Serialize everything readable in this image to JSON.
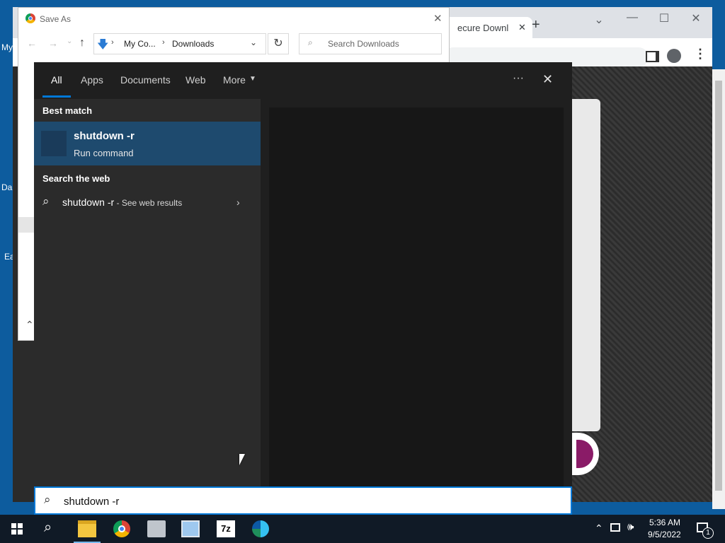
{
  "desktop": {
    "fragments": [
      "My",
      "Da",
      "Ea"
    ]
  },
  "chrome": {
    "tab_title": "ecure Downl",
    "close_tab": "✕",
    "new_tab": "+"
  },
  "save_as": {
    "title": "Save As",
    "breadcrumb": [
      "My Co...",
      "Downloads"
    ],
    "search_placeholder": "Search Downloads"
  },
  "search_panel": {
    "tabs": [
      "All",
      "Apps",
      "Documents",
      "Web",
      "More"
    ],
    "active_tab": "All",
    "best_match_header": "Best match",
    "best_match": {
      "title": "shutdown -r",
      "subtitle": "Run command"
    },
    "web_header": "Search the web",
    "web_result": {
      "query": "shutdown -r",
      "suffix": " - See web results"
    }
  },
  "search_box": {
    "value": "shutdown -r "
  },
  "taskbar": {
    "apps": [
      "file-explorer-icon",
      "chrome-icon",
      "app-icon",
      "network-app-icon",
      "7zip-icon",
      "edge-icon"
    ],
    "time": "5:36 AM",
    "date": "9/5/2022",
    "notification_count": "1"
  },
  "colors": {
    "accent": "#0078d7",
    "panel": "#1f1f1f",
    "best_match_bg": "#1e4a6e"
  }
}
